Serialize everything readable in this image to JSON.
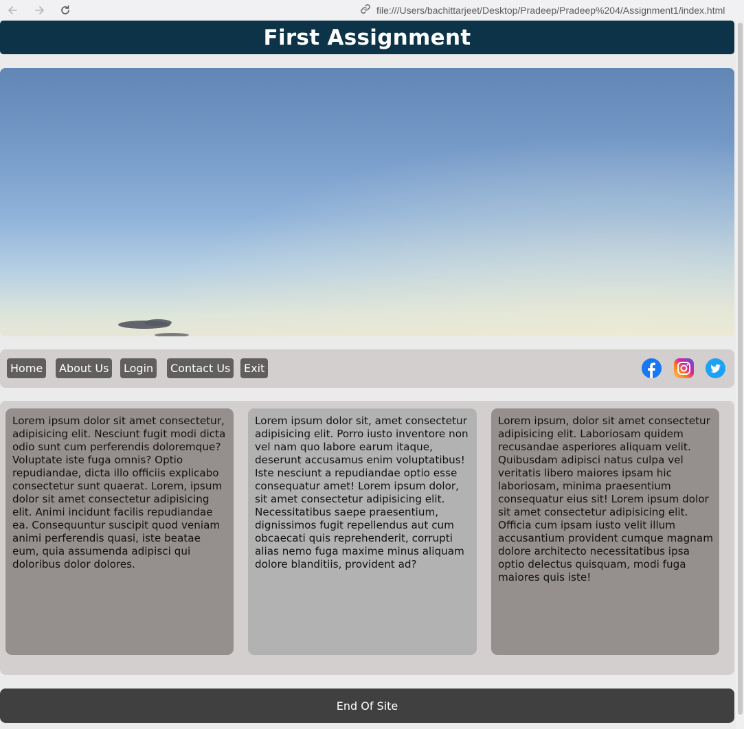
{
  "browser": {
    "url": "file:///Users/bachittarjeet/Desktop/Pradeep/Pradeep%204/Assignment1/index.html",
    "back_icon": "arrow-left-icon",
    "forward_icon": "arrow-right-icon",
    "reload_icon": "reload-icon",
    "link_icon": "link-icon"
  },
  "header": {
    "title": "First Assignment",
    "bg_color": "#0c3347"
  },
  "hero": {
    "image": "evening-sky-photo"
  },
  "nav": {
    "items": [
      {
        "label": "Home"
      },
      {
        "label": "About Us"
      },
      {
        "label": "Login"
      },
      {
        "label": "Contact Us"
      },
      {
        "label": "Exit"
      }
    ],
    "button_color": "#605f5e",
    "social": [
      {
        "icon": "facebook-icon",
        "color": "#1877f2"
      },
      {
        "icon": "instagram-icon",
        "color": "#d6249f"
      },
      {
        "icon": "twitter-icon",
        "color": "#1da1f2"
      }
    ]
  },
  "content": {
    "cards": [
      {
        "text": "Lorem ipsum dolor sit amet consectetur, adipisicing elit. Nesciunt fugit modi dicta odio sunt cum perferendis doloremque? Voluptate iste fuga omnis? Optio repudiandae, dicta illo officiis explicabo consectetur sunt quaerat. Lorem, ipsum dolor sit amet consectetur adipisicing elit. Animi incidunt facilis repudiandae ea. Consequuntur suscipit quod veniam animi perferendis quasi, iste beatae eum, quia assumenda adipisci qui doloribus dolor dolores."
      },
      {
        "text": "Lorem ipsum dolor sit, amet consectetur adipisicing elit. Porro iusto inventore non vel nam quo labore earum itaque, deserunt accusamus enim voluptatibus! Iste nesciunt a repudiandae optio esse consequatur amet! Lorem ipsum dolor, sit amet consectetur adipisicing elit. Necessitatibus saepe praesentium, dignissimos fugit repellendus aut cum obcaecati quis reprehenderit, corrupti alias nemo fuga maxime minus aliquam dolore blanditiis, provident ad?"
      },
      {
        "text": "Lorem ipsum, dolor sit amet consectetur adipisicing elit. Laboriosam quidem recusandae asperiores aliquam velit. Quibusdam adipisci natus culpa vel veritatis libero maiores ipsam hic laboriosam, minima praesentium consequatur eius sit! Lorem ipsum dolor sit amet consectetur adipisicing elit. Officia cum ipsam iusto velit illum accusantium provident cumque magnam dolore architecto necessitatibus ipsa optio delectus quisquam, modi fuga maiores quis iste!"
      }
    ]
  },
  "footer": {
    "text": "End Of Site",
    "bg_color": "#404040"
  }
}
